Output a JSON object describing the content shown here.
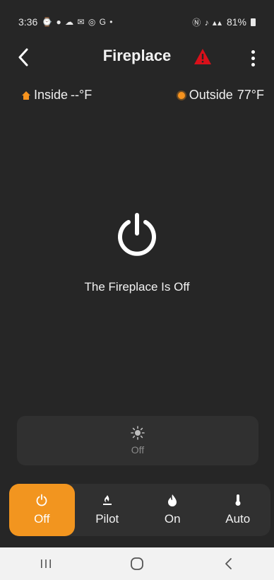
{
  "status_bar": {
    "time": "3:36",
    "left_icons": "⌚ ● ☁ ✉ ◎ G •",
    "right_icons": "Ⓝ ♪ ▴▴",
    "battery": "81%"
  },
  "app_bar": {
    "title": "Fireplace",
    "alert_color": "#d9101a"
  },
  "temperatures": {
    "inside_label": "Inside",
    "inside_value": "--°F",
    "outside_label": "Outside",
    "outside_value": "77°F"
  },
  "fireplace": {
    "status_text": "The Fireplace Is Off"
  },
  "light": {
    "label": "Off"
  },
  "modes": [
    {
      "label": "Off",
      "icon": "power-icon",
      "active": true
    },
    {
      "label": "Pilot",
      "icon": "pilot-icon",
      "active": false
    },
    {
      "label": "On",
      "icon": "flame-icon",
      "active": false
    },
    {
      "label": "Auto",
      "icon": "thermometer-icon",
      "active": false
    }
  ],
  "colors": {
    "accent": "#f2951f",
    "background": "#262626"
  }
}
